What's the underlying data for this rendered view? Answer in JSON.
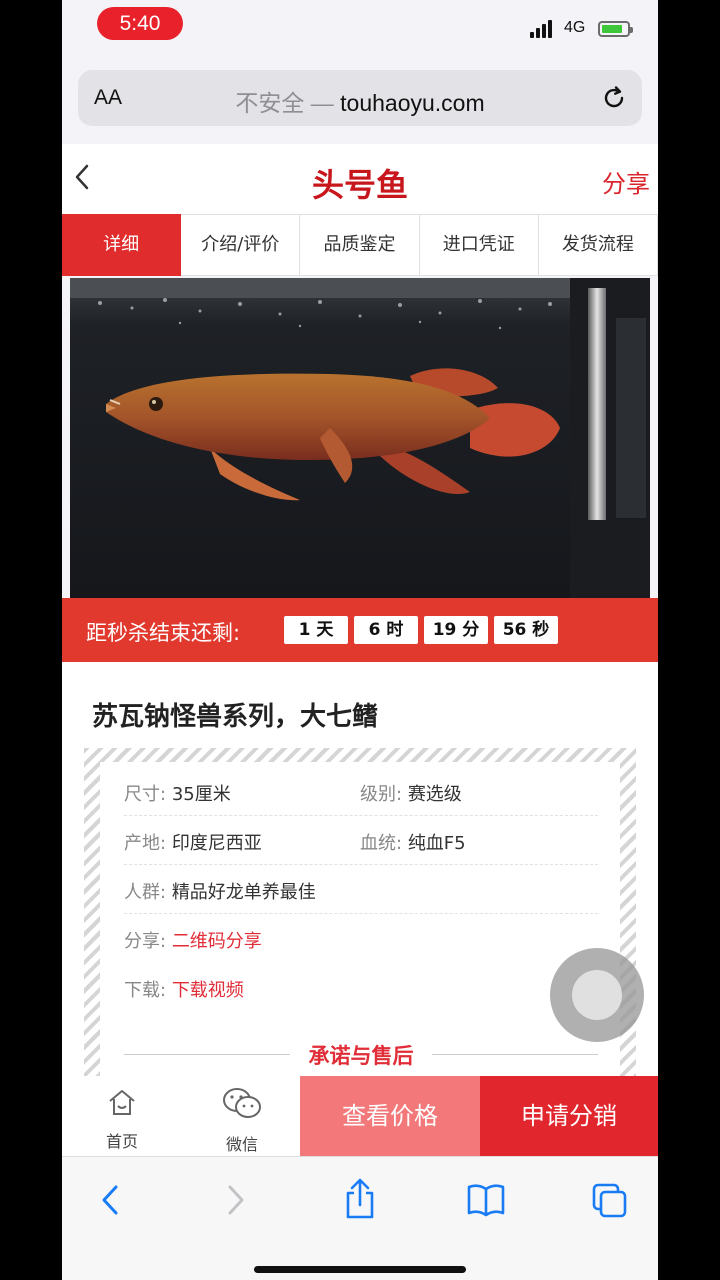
{
  "status_bar": {
    "time": "5:40",
    "network": "4G"
  },
  "browser": {
    "text_size_label": "AA",
    "url_insecure": "不安全 —",
    "url_domain": "touhaoyu.com"
  },
  "header": {
    "title": "头号鱼",
    "share_label": "分享"
  },
  "tabs": [
    {
      "label": "详细",
      "active": true
    },
    {
      "label": "介绍/评价",
      "active": false
    },
    {
      "label": "品质鉴定",
      "active": false
    },
    {
      "label": "进口凭证",
      "active": false
    },
    {
      "label": "发货流程",
      "active": false
    }
  ],
  "countdown": {
    "label": "距秒杀结束还剩:",
    "days": "1 天",
    "hours": "6 时",
    "minutes": "19 分",
    "seconds": "56 秒"
  },
  "product": {
    "title": "苏瓦钠怪兽系列，大七鳍",
    "size_key": "尺寸:",
    "size_value": "35厘米",
    "grade_key": "级别:",
    "grade_value": "赛选级",
    "origin_key": "产地:",
    "origin_value": "印度尼西亚",
    "lineage_key": "血统:",
    "lineage_value": "纯血F5",
    "audience_key": "人群:",
    "audience_value": "精品好龙单养最佳",
    "share_key": "分享:",
    "share_value": "二维码分享",
    "download_key": "下载:",
    "download_value": "下载视频",
    "promise": "承诺与售后"
  },
  "bottom_bar": {
    "home_label": "首页",
    "wechat_label": "微信",
    "price_button": "查看价格",
    "distribution_button": "申请分销"
  },
  "colors": {
    "brand_red": "#e02c2c",
    "price_button": "#f2787a",
    "link_red": "#e02d37",
    "ios_blue": "#1a7cf5"
  }
}
